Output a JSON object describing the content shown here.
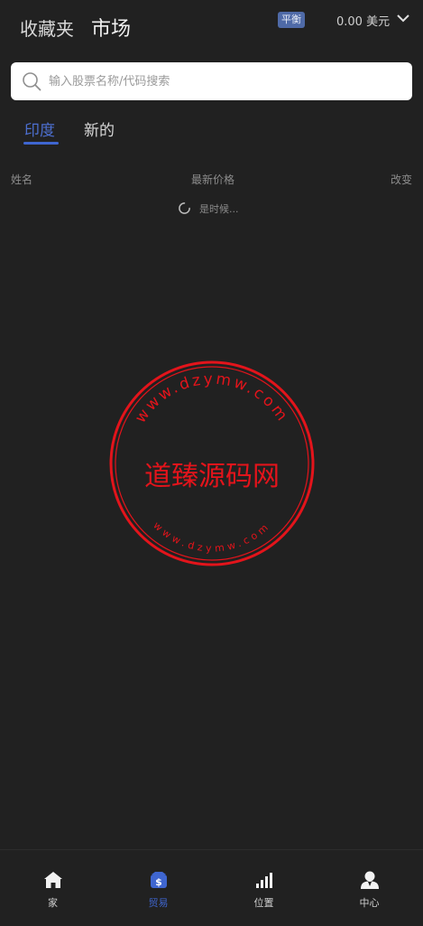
{
  "header": {
    "favorites_tab": "收藏夹",
    "market_tab": "市场",
    "balance_badge": "平衡",
    "balance_amount": "0.00 美元"
  },
  "search": {
    "placeholder": "输入股票名称/代码搜索"
  },
  "tabs": [
    {
      "label": "印度",
      "active": true
    },
    {
      "label": "新的",
      "active": false
    }
  ],
  "table": {
    "columns": [
      "姓名",
      "最新价格",
      "改变"
    ]
  },
  "loading_text": "是时候...",
  "watermark": {
    "main_text": "道臻源码网",
    "ring_text": "www.dzymw.com"
  },
  "bottom_nav": [
    {
      "label": "家",
      "icon": "home-icon",
      "active": false
    },
    {
      "label": "贸易",
      "icon": "trade-wallet-icon",
      "active": true
    },
    {
      "label": "位置",
      "icon": "bar-chart-icon",
      "active": false
    },
    {
      "label": "中心",
      "icon": "user-icon",
      "active": false
    }
  ],
  "colors": {
    "background": "#212121",
    "accent": "#3f66d0",
    "stamp_red": "#e3141b",
    "badge": "#4f6aa7"
  }
}
